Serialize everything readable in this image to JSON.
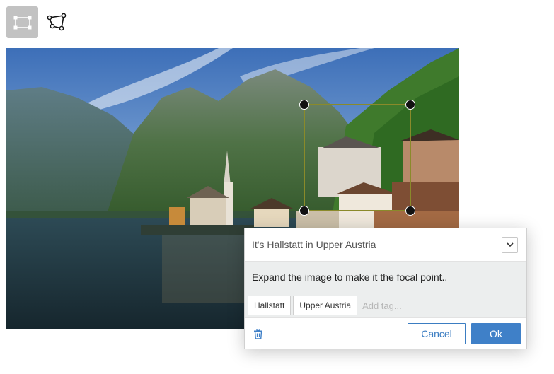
{
  "toolbar": {
    "tools": [
      {
        "name": "rectangle",
        "icon": "rectangle-select-icon",
        "active": true
      },
      {
        "name": "polygon",
        "icon": "polygon-select-icon",
        "active": false
      }
    ]
  },
  "annotation": {
    "title": "It's Hallstatt in Upper Austria",
    "comment": "Expand the image to make it the focal point..",
    "tags": [
      "Hallstatt",
      "Upper Austria"
    ],
    "tag_placeholder": "Add tag...",
    "delete_icon": "trash-icon",
    "cancel_label": "Cancel",
    "ok_label": "Ok"
  },
  "colors": {
    "accent": "#3f80c8",
    "active_tool_bg": "#c2c2c2",
    "selection_border": "#8a8a2a"
  }
}
